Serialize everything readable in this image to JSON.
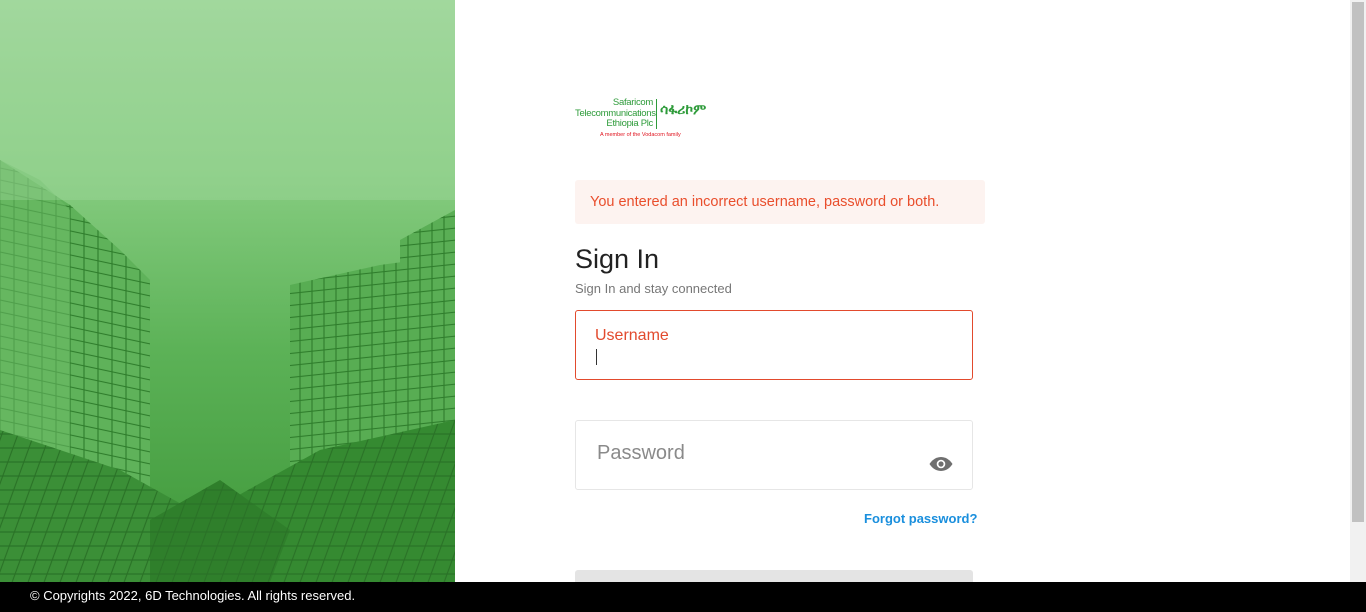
{
  "logo": {
    "line1": "Safaricom",
    "line2": "Telecommunications",
    "line3": "Ethiopia Plc",
    "amharic": "ሳፋሪኮም",
    "tagline": "A member of the Vodacom family"
  },
  "error": {
    "message": "You entered an incorrect username, password or both."
  },
  "signin": {
    "title": "Sign In",
    "subtitle": "Sign In and stay connected"
  },
  "username_field": {
    "label": "Username",
    "value": ""
  },
  "password_field": {
    "placeholder": "Password",
    "value": "",
    "toggle_icon": "eye-icon"
  },
  "forgot_password": {
    "label": "Forgot password?"
  },
  "footer": {
    "text": "© Copyrights 2022, 6D Technologies. All rights reserved."
  },
  "colors": {
    "brand_green": "#2e9b3a",
    "error_red": "#e24a2d",
    "link_blue": "#1a8fdd"
  }
}
